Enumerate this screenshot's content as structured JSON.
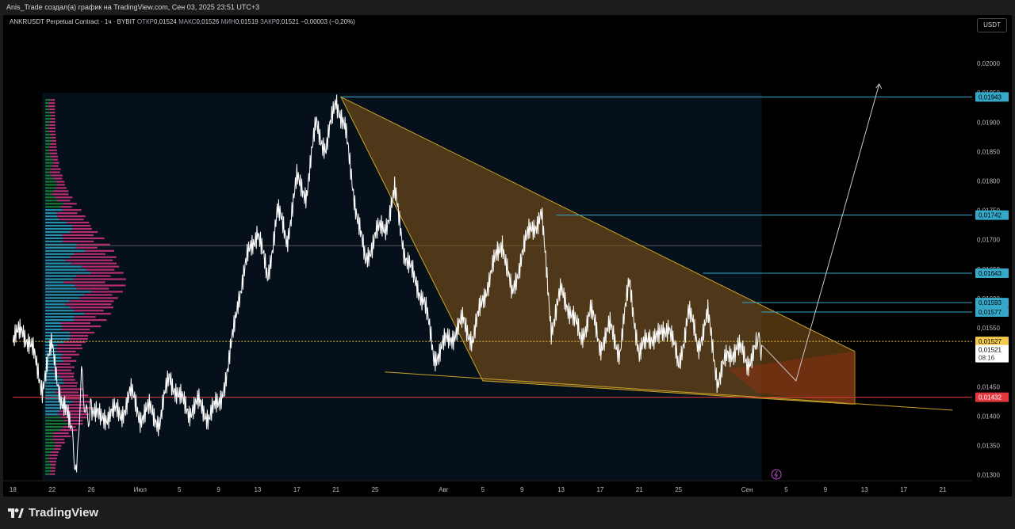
{
  "header": {
    "attribution": "Anis_Trade создал(а) график на TradingView.com, Сен 03, 2025 23:51 UTC+3"
  },
  "legend": {
    "symbol": "ANKRUSDT Perpetual Contract · 1ч · BYBIT",
    "open_label": "ОТКР",
    "open": "0,01524",
    "high_label": "МАКС",
    "high": "0,01526",
    "low_label": "МИН",
    "low": "0,01519",
    "close_label": "ЗАКР",
    "close": "0,01521",
    "change": "−0,00003 (−0,20%)"
  },
  "currency_button": "USDT",
  "brand": "TradingView",
  "colors": {
    "background": "#000000",
    "frame": "#1c1c1c",
    "price_line": "#ffffff",
    "level_line": "#36a9c9",
    "support_line": "#e0383e",
    "wedge_fill": "#8a5a1a",
    "wedge_stroke": "#c9a227",
    "volume_buy": "#2ba6c7",
    "volume_sell": "#d63384",
    "volume_green": "#1b8a3a"
  },
  "icons": [
    "lightning-icon",
    "tradingview-logo-icon"
  ],
  "chart_data": {
    "type": "line",
    "title": "ANKRUSDT Perpetual Contract · 1ч · BYBIT",
    "ylim": [
      0.0129,
      0.0205
    ],
    "y_ticks": [
      "0,02000",
      "0,01950",
      "0,01900",
      "0,01850",
      "0,01800",
      "0,01750",
      "0,01700",
      "0,01650",
      "0,01600",
      "0,01550",
      "0,01500",
      "0,01450",
      "0,01400",
      "0,01350",
      "0,01300"
    ],
    "x_ticks": [
      "18",
      "22",
      "26",
      "Июл",
      "5",
      "9",
      "13",
      "17",
      "21",
      "25",
      "Авг",
      "5",
      "9",
      "13",
      "17",
      "21",
      "25",
      "Сен",
      "5",
      "9",
      "13",
      "17",
      "21"
    ],
    "x_tick_values": [
      0,
      4,
      8,
      13,
      17,
      21,
      25,
      29,
      33,
      37,
      44,
      48,
      52,
      56,
      60,
      64,
      68,
      75,
      79,
      83,
      87,
      91,
      95
    ],
    "series": [
      {
        "x": [
          0,
          1,
          2,
          3,
          4,
          5,
          6,
          6.5,
          7,
          7.5,
          8,
          9,
          10,
          11,
          12,
          13,
          14,
          15,
          16,
          17,
          18,
          19,
          20,
          21,
          22,
          23,
          24,
          25,
          26,
          27,
          28,
          29,
          30,
          31,
          32,
          33,
          34,
          35,
          36,
          37,
          38,
          39,
          40,
          41,
          42,
          43,
          44,
          45,
          46,
          47,
          48,
          49,
          50,
          51,
          52,
          53,
          54,
          55,
          56,
          57,
          58,
          59,
          60,
          61,
          62,
          63,
          64,
          65,
          66,
          67,
          68,
          69,
          70,
          71,
          72,
          73,
          74,
          75,
          76,
          76.5
        ],
        "values": [
          0.01525,
          0.0155,
          0.0151,
          0.0145,
          0.0152,
          0.0142,
          0.0138,
          0.013,
          0.0146,
          0.014,
          0.0142,
          0.0139,
          0.0141,
          0.014,
          0.0144,
          0.014,
          0.0141,
          0.0139,
          0.0147,
          0.0143,
          0.0141,
          0.0142,
          0.014,
          0.0142,
          0.0148,
          0.016,
          0.0167,
          0.0172,
          0.0163,
          0.0175,
          0.017,
          0.018,
          0.0178,
          0.019,
          0.0185,
          0.01943,
          0.0188,
          0.0176,
          0.0166,
          0.0171,
          0.0172,
          0.0178,
          0.0168,
          0.0163,
          0.016,
          0.015,
          0.0152,
          0.0154,
          0.0156,
          0.0153,
          0.016,
          0.0165,
          0.017,
          0.016,
          0.0168,
          0.0172,
          0.01742,
          0.0155,
          0.0161,
          0.0158,
          0.0153,
          0.0158,
          0.0152,
          0.0155,
          0.0151,
          0.0163,
          0.015,
          0.0154,
          0.0153,
          0.0156,
          0.0148,
          0.0158,
          0.0152,
          0.0157,
          0.0146,
          0.015,
          0.0152,
          0.0149,
          0.01521,
          0.01521
        ]
      }
    ],
    "levels": [
      {
        "price": 0.01943,
        "label": "0,01943",
        "color": "#36a9c9"
      },
      {
        "price": 0.01742,
        "label": "0,01742",
        "color": "#36a9c9"
      },
      {
        "price": 0.01643,
        "label": "0,01643",
        "color": "#36a9c9"
      },
      {
        "price": 0.01593,
        "label": "0,01593",
        "color": "#36a9c9"
      },
      {
        "price": 0.01577,
        "label": "0,01577",
        "color": "#36a9c9"
      },
      {
        "price": 0.01527,
        "label": "0,01527",
        "color": "#f2c94c"
      },
      {
        "price": 0.01432,
        "label": "0,01432",
        "color": "#e0383e"
      }
    ],
    "last_price": {
      "price": 0.01521,
      "label": "0,01521",
      "countdown": "08:16"
    }
  }
}
